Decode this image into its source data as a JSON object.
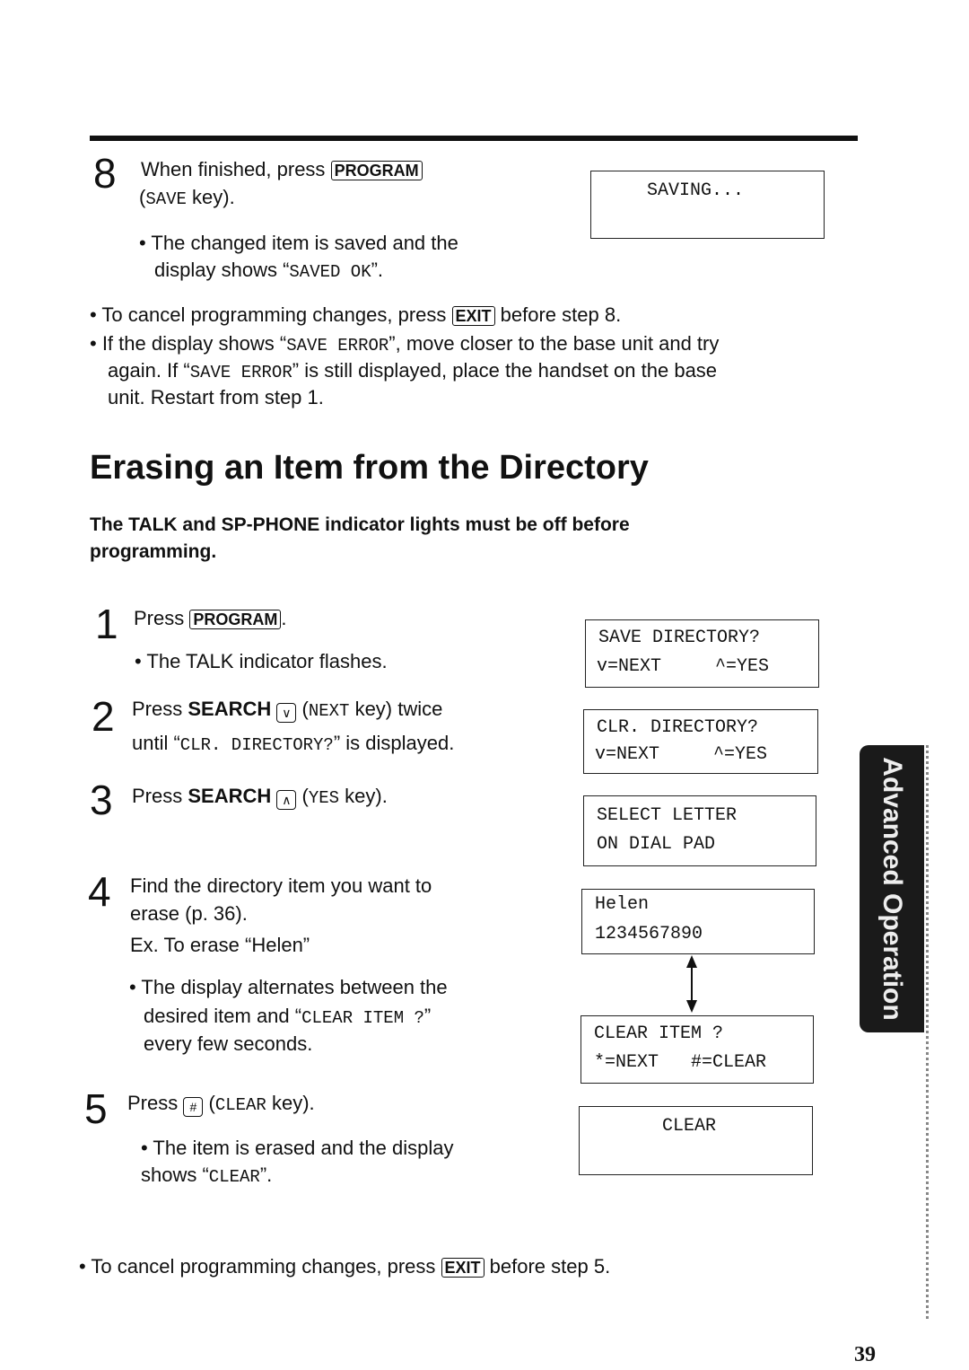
{
  "step8": {
    "number": "8",
    "line1": "When finished, press",
    "key": "PROGRAM",
    "line2a": "(",
    "line2mono": "SAVE",
    "line2b": " key).",
    "bullet1": "• The changed item is saved and the",
    "bullet2a": "display shows “",
    "bullet2mono": "SAVED OK",
    "bullet2b": "”.",
    "display": "SAVING..."
  },
  "notes": {
    "n1a": "• To cancel programming changes, press",
    "n1key": "EXIT",
    "n1b": "before step 8.",
    "n2a": "• If the display shows “",
    "n2mono": "SAVE ERROR",
    "n2b": "”, move closer to the base unit and try",
    "n3a": "again. If “",
    "n3mono": "SAVE ERROR",
    "n3b": "” is still displayed, place the handset on the base",
    "n4": "unit. Restart from step 1."
  },
  "section": {
    "title": "Erasing an Item from the Directory",
    "subtitle1": "The TALK and SP-PHONE indicator lights must be off before",
    "subtitle2": "programming."
  },
  "steps": [
    {
      "number": "1",
      "text": "Press",
      "key": "PROGRAM",
      "tail": ".",
      "bullet": "• The TALK indicator flashes."
    },
    {
      "number": "2",
      "pre": "Press ",
      "bold": "SEARCH",
      "icon": "chevron-down-key",
      "mono": "NEXT",
      "post": " key) twice",
      "line2a": "until “",
      "line2mono": "CLR. DIRECTORY?",
      "line2b": "” is displayed."
    },
    {
      "number": "3",
      "pre": "Press ",
      "bold": "SEARCH",
      "icon": "chevron-up-key",
      "mono": "YES",
      "post": " key)."
    },
    {
      "number": "4",
      "line1": "Find the directory item you want to",
      "line2": "erase (p. 36).",
      "line3": "Ex. To erase “Helen”",
      "b1": "• The display alternates between the",
      "b2a": "desired item and “",
      "b2mono": "CLEAR ITEM ?",
      "b2b": "”",
      "b3": "every few seconds."
    },
    {
      "number": "5",
      "pre": "Press",
      "key": "#",
      "mono": "CLEAR",
      "post": " key).",
      "b1": "• The item is erased and the display",
      "b2a": "shows “",
      "b2mono": "CLEAR",
      "b2b": "”."
    }
  ],
  "displays": [
    {
      "l1": "SAVE DIRECTORY?",
      "l2": "v=NEXT     ^=YES"
    },
    {
      "l1": "CLR. DIRECTORY?",
      "l2": "v=NEXT     ^=YES"
    },
    {
      "l1": "SELECT LETTER",
      "l2": "ON DIAL PAD"
    },
    {
      "l1": "Helen",
      "l2": "1234567890"
    },
    {
      "l1": "CLEAR ITEM ?",
      "l2": "*=NEXT   #=CLEAR"
    },
    {
      "l1": "CLEAR",
      "l2": ""
    }
  ],
  "footer_note": {
    "a": "• To cancel programming changes, press",
    "key": "EXIT",
    "b": "before step 5."
  },
  "side_tab": "Advanced Operation",
  "page_number": "39"
}
